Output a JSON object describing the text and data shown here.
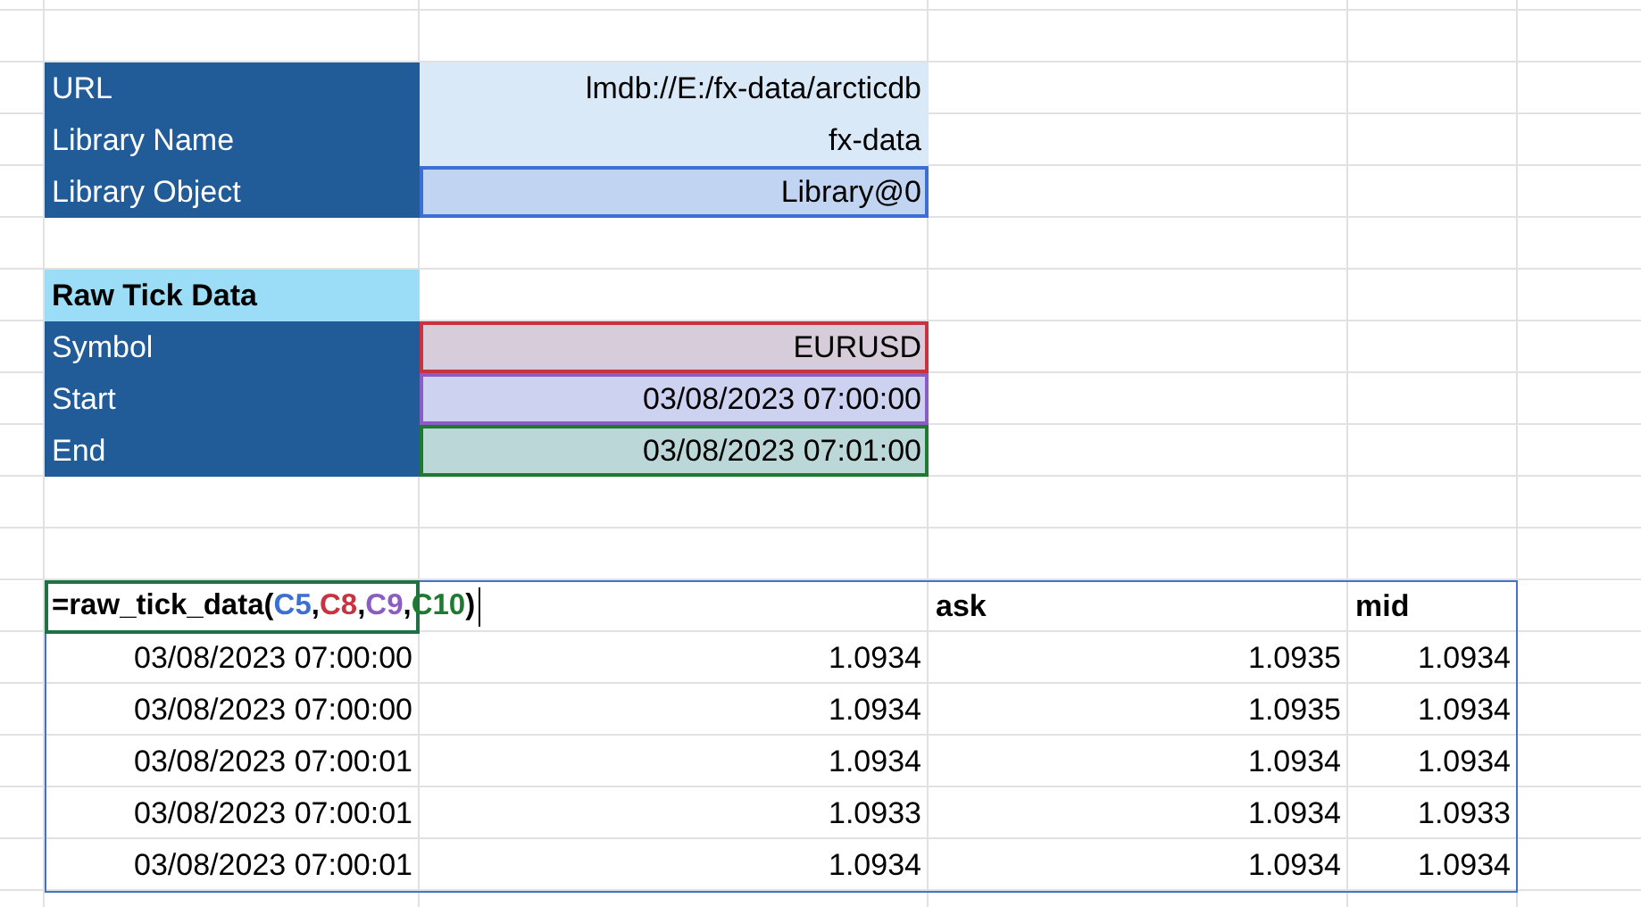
{
  "connection": [
    {
      "label": "URL",
      "value": "lmdb://E:/fx-data/arcticdb"
    },
    {
      "label": "Library Name",
      "value": "fx-data"
    },
    {
      "label": "Library Object",
      "value": "Library@0",
      "color": "#3b6fd3"
    }
  ],
  "raw_tick_data": {
    "title": "Raw Tick Data",
    "params": [
      {
        "label": "Symbol",
        "value": "EURUSD",
        "color": "#c8333f"
      },
      {
        "label": "Start",
        "value": "03/08/2023 07:00:00",
        "color": "#8b5cc4"
      },
      {
        "label": "End",
        "value": "03/08/2023 07:01:00",
        "color": "#1f7a31"
      }
    ]
  },
  "formula": [
    {
      "text": "=raw_tick_data("
    },
    {
      "text": "C5",
      "color": "#3b6fd3"
    },
    {
      "text": ","
    },
    {
      "text": "C8",
      "color": "#c8333f"
    },
    {
      "text": ","
    },
    {
      "text": "C9",
      "color": "#8b5cc4"
    },
    {
      "text": ","
    },
    {
      "text": "C10",
      "color": "#1f7a31"
    },
    {
      "text": ")"
    }
  ],
  "results": {
    "headers": [
      "ask",
      "mid"
    ],
    "rows": [
      [
        "03/08/2023 07:00:00",
        "1.0934",
        "1.0935",
        "1.0934"
      ],
      [
        "03/08/2023 07:00:00",
        "1.0934",
        "1.0935",
        "1.0934"
      ],
      [
        "03/08/2023 07:00:01",
        "1.0934",
        "1.0934",
        "1.0934"
      ],
      [
        "03/08/2023 07:00:01",
        "1.0933",
        "1.0934",
        "1.0933"
      ],
      [
        "03/08/2023 07:00:01",
        "1.0934",
        "1.0934",
        "1.0934"
      ]
    ]
  }
}
